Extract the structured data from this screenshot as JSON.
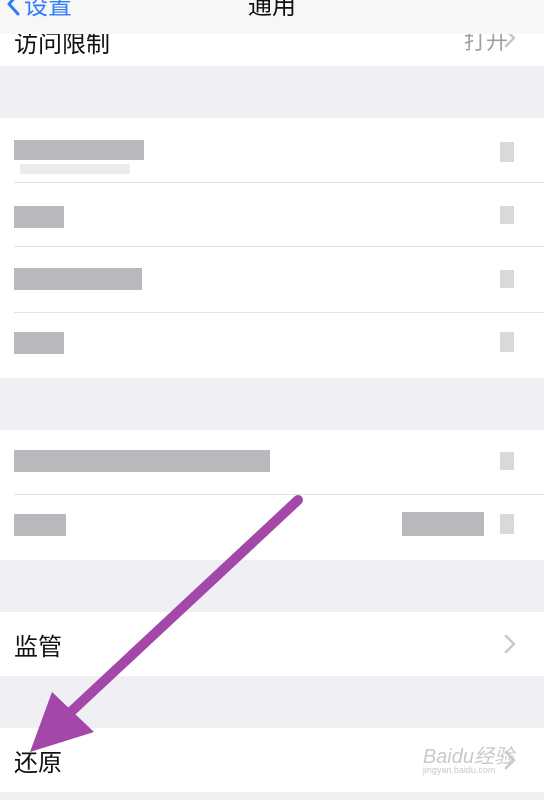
{
  "nav": {
    "back_label": "设置",
    "title": "通用"
  },
  "rows": {
    "restrictions": {
      "label": "访问限制",
      "value": "打开"
    },
    "supervision": {
      "label": "监管"
    },
    "reset": {
      "label": "还原"
    }
  },
  "watermark": {
    "brand": "Baidu经验",
    "url": "jingyan.baidu.com"
  },
  "colors": {
    "accent": "#2f7cf6",
    "arrow": "#a347a9",
    "background": "#efeff4"
  }
}
